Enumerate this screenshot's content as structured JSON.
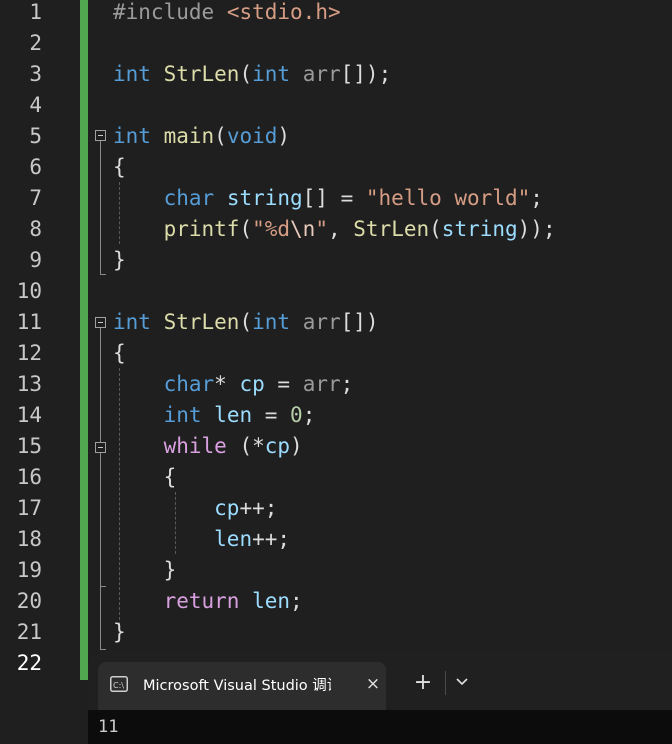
{
  "editor": {
    "line_numbers": [
      "1",
      "2",
      "3",
      "4",
      "5",
      "6",
      "7",
      "8",
      "9",
      "10",
      "11",
      "12",
      "13",
      "14",
      "15",
      "16",
      "17",
      "18",
      "19",
      "20",
      "21",
      "22"
    ],
    "current_line": "22",
    "code": {
      "l1_directive": "#include",
      "l1_header": "<stdio.h>",
      "l3_type": "int",
      "l3_fn": "StrLen",
      "l3_open": "(",
      "l3_ptype": "int",
      "l3_param": "arr",
      "l3_close": "[]);",
      "l5_type": "int",
      "l5_fn": "main",
      "l5_open": "(",
      "l5_void": "void",
      "l5_close": ")",
      "l6_brace": "{",
      "l7_type": "char",
      "l7_var": "string",
      "l7_mid": "[] = ",
      "l7_str_a": "\"hello world\"",
      "l7_end": ";",
      "l8_fn": "printf",
      "l8_open": "(",
      "l8_str_a": "\"%d",
      "l8_esc": "\\n",
      "l8_str_b": "\"",
      "l8_comma": ", ",
      "l8_fn2": "StrLen",
      "l8_open2": "(",
      "l8_var": "string",
      "l8_end": "));",
      "l9_brace": "}",
      "l11_type": "int",
      "l11_fn": "StrLen",
      "l11_open": "(",
      "l11_ptype": "int",
      "l11_param": "arr",
      "l11_close": "[])",
      "l12_brace": "{",
      "l13_type": "char",
      "l13_star": "* ",
      "l13_var": "cp",
      "l13_eq": " = ",
      "l13_param": "arr",
      "l13_end": ";",
      "l14_type": "int",
      "l14_var": "len",
      "l14_eq": " = ",
      "l14_num": "0",
      "l14_end": ";",
      "l15_kw": "while",
      "l15_open": " (*",
      "l15_var": "cp",
      "l15_close": ")",
      "l16_brace": "{",
      "l17_var": "cp",
      "l17_op": "++;",
      "l18_var": "len",
      "l18_op": "++;",
      "l19_brace": "}",
      "l20_kw": "return",
      "l20_var": "len",
      "l20_end": ";",
      "l21_brace": "}"
    }
  },
  "terminal": {
    "tab_title": "Microsoft Visual Studio 调试控制台",
    "close_icon": "×",
    "new_tab_icon": "+",
    "output": "11"
  },
  "colors": {
    "editor_bg": "#1f1f1f",
    "change_bar": "#51a74f",
    "keyword": "#569cd6",
    "control": "#d8a0df",
    "function": "#dcdcaa",
    "variable": "#9cdcfe",
    "string": "#d69d85"
  }
}
